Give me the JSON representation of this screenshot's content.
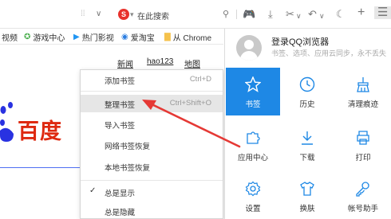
{
  "toolbar": {
    "search_placeholder": "在此搜索"
  },
  "bookmarks": [
    {
      "label": "视频"
    },
    {
      "label": "游戏中心"
    },
    {
      "label": "热门影视"
    },
    {
      "label": "爱淘宝"
    },
    {
      "label": "从 Chrome"
    }
  ],
  "page": {
    "links": [
      "新闻",
      "hao123",
      "地图"
    ],
    "logo_text": "百度"
  },
  "context_menu": {
    "items": [
      {
        "label": "添加书签",
        "shortcut": "Ctrl+D"
      },
      {
        "label": "整理书签",
        "shortcut": "Ctrl+Shift+O"
      },
      {
        "label": "导入书签",
        "shortcut": ""
      },
      {
        "label": "网络书签恢复",
        "shortcut": ""
      },
      {
        "label": "本地书签恢复",
        "shortcut": ""
      },
      {
        "label": "总是显示",
        "shortcut": ""
      },
      {
        "label": "总是隐藏",
        "shortcut": ""
      }
    ]
  },
  "panel": {
    "login_title": "登录QQ浏览器",
    "login_subtitle": "书签、选项、应用云同步，永不丢失",
    "tiles": [
      {
        "label": "书签",
        "icon": "star-icon"
      },
      {
        "label": "历史",
        "icon": "clock-icon"
      },
      {
        "label": "清理痕迹",
        "icon": "broom-icon"
      },
      {
        "label": "应用中心",
        "icon": "puzzle-icon"
      },
      {
        "label": "下载",
        "icon": "download-icon"
      },
      {
        "label": "打印",
        "icon": "printer-icon"
      },
      {
        "label": "设置",
        "icon": "gear-icon"
      },
      {
        "label": "换肤",
        "icon": "shirt-icon"
      },
      {
        "label": "帐号助手",
        "icon": "key-icon"
      }
    ]
  },
  "colors": {
    "accent_blue": "#1e88e5",
    "arrow_red": "#e53935",
    "baidu_red": "#de2910",
    "baidu_blue": "#2932e1"
  }
}
